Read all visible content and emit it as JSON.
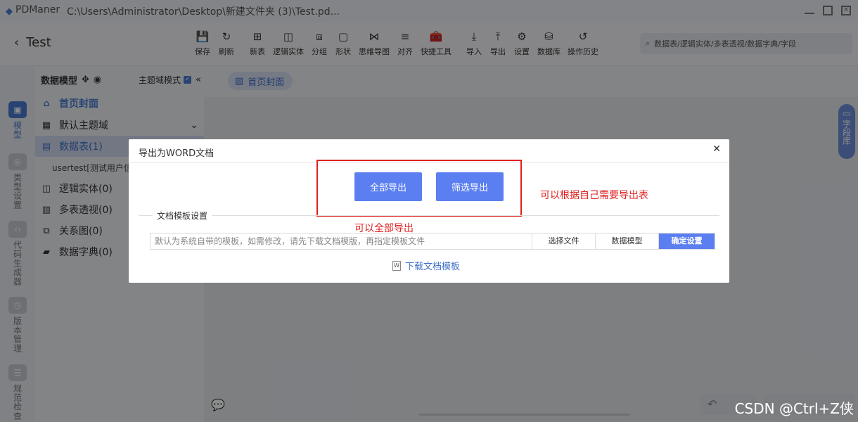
{
  "titlebar": {
    "app": "PDManer",
    "path": "C:\\Users\\Administrator\\Desktop\\新建文件夹 (3)\\Test.pd..."
  },
  "header": {
    "project": "Test",
    "tools": [
      {
        "icon": "save-icon",
        "glyph": "💾",
        "label": "保存"
      },
      {
        "icon": "refresh-icon",
        "glyph": "↻",
        "label": "刷新"
      },
      {
        "icon": "new-table-icon",
        "glyph": "⊞",
        "label": "新表"
      },
      {
        "icon": "logic-entity-icon",
        "glyph": "◫",
        "label": "逻辑实体"
      },
      {
        "icon": "group-icon",
        "glyph": "⧈",
        "label": "分组"
      },
      {
        "icon": "shape-icon",
        "glyph": "▢",
        "label": "形状"
      },
      {
        "icon": "mindmap-icon",
        "glyph": "⋈",
        "label": "思维导图"
      },
      {
        "icon": "align-icon",
        "glyph": "≡",
        "label": "对齐"
      },
      {
        "icon": "toolbox-icon",
        "glyph": "🧰",
        "label": "快捷工具"
      },
      {
        "icon": "import-icon",
        "glyph": "⤓",
        "label": "导入"
      },
      {
        "icon": "export-icon",
        "glyph": "⤒",
        "label": "导出"
      },
      {
        "icon": "settings-icon",
        "glyph": "⚙",
        "label": "设置"
      },
      {
        "icon": "database-icon",
        "glyph": "⛁",
        "label": "数据库"
      },
      {
        "icon": "history-icon",
        "glyph": "↺",
        "label": "操作历史"
      }
    ],
    "search_placeholder": "数据表/逻辑实体/多表透视/数据字典/字段"
  },
  "rail": [
    {
      "label": "模型",
      "active": true
    },
    {
      "label": "类型设置",
      "active": false
    },
    {
      "label": "代码生成器",
      "active": false
    },
    {
      "label": "版本管理",
      "active": false
    },
    {
      "label": "规范检查",
      "active": false
    }
  ],
  "sidebar": {
    "title": "数据模型",
    "mode_label": "主题域模式",
    "items": {
      "cover": "首页封面",
      "domain": "默认主题域",
      "tables": "数据表(1)",
      "table_item": "usertest[测试用户信",
      "entities": "逻辑实体(0)",
      "views": "多表透视(0)",
      "diagrams": "关系图(0)",
      "dicts": "数据字典(0)"
    }
  },
  "main": {
    "tab": "首页封面",
    "right_tab": "字段库"
  },
  "dialog": {
    "title": "导出为WORD文档",
    "export_all": "全部导出",
    "export_filter": "筛选导出",
    "note_right": "可以根据自己需要导出表",
    "note_below": "可以全部导出",
    "section": "文档模板设置",
    "template_placeholder": "默认为系统自带的模板，如需修改，请先下载文档模版，再指定模板文件",
    "choose_file": "选择文件",
    "data_model": "数据模型",
    "confirm": "确定设置",
    "download": "下载文档模板"
  },
  "watermark": "CSDN @Ctrl+Z侠",
  "colors": {
    "accent": "#5b7ff0",
    "annotation": "#e02020"
  }
}
